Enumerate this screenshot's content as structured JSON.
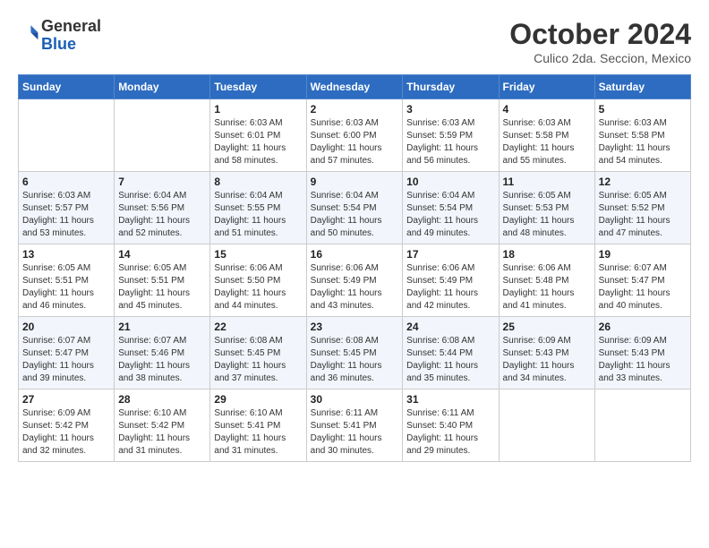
{
  "header": {
    "logo": {
      "line1": "General",
      "line2": "Blue"
    },
    "title": "October 2024",
    "location": "Culico 2da. Seccion, Mexico"
  },
  "weekdays": [
    "Sunday",
    "Monday",
    "Tuesday",
    "Wednesday",
    "Thursday",
    "Friday",
    "Saturday"
  ],
  "weeks": [
    [
      {
        "day": "",
        "info": ""
      },
      {
        "day": "",
        "info": ""
      },
      {
        "day": "1",
        "info": "Sunrise: 6:03 AM\nSunset: 6:01 PM\nDaylight: 11 hours\nand 58 minutes."
      },
      {
        "day": "2",
        "info": "Sunrise: 6:03 AM\nSunset: 6:00 PM\nDaylight: 11 hours\nand 57 minutes."
      },
      {
        "day": "3",
        "info": "Sunrise: 6:03 AM\nSunset: 5:59 PM\nDaylight: 11 hours\nand 56 minutes."
      },
      {
        "day": "4",
        "info": "Sunrise: 6:03 AM\nSunset: 5:58 PM\nDaylight: 11 hours\nand 55 minutes."
      },
      {
        "day": "5",
        "info": "Sunrise: 6:03 AM\nSunset: 5:58 PM\nDaylight: 11 hours\nand 54 minutes."
      }
    ],
    [
      {
        "day": "6",
        "info": "Sunrise: 6:03 AM\nSunset: 5:57 PM\nDaylight: 11 hours\nand 53 minutes."
      },
      {
        "day": "7",
        "info": "Sunrise: 6:04 AM\nSunset: 5:56 PM\nDaylight: 11 hours\nand 52 minutes."
      },
      {
        "day": "8",
        "info": "Sunrise: 6:04 AM\nSunset: 5:55 PM\nDaylight: 11 hours\nand 51 minutes."
      },
      {
        "day": "9",
        "info": "Sunrise: 6:04 AM\nSunset: 5:54 PM\nDaylight: 11 hours\nand 50 minutes."
      },
      {
        "day": "10",
        "info": "Sunrise: 6:04 AM\nSunset: 5:54 PM\nDaylight: 11 hours\nand 49 minutes."
      },
      {
        "day": "11",
        "info": "Sunrise: 6:05 AM\nSunset: 5:53 PM\nDaylight: 11 hours\nand 48 minutes."
      },
      {
        "day": "12",
        "info": "Sunrise: 6:05 AM\nSunset: 5:52 PM\nDaylight: 11 hours\nand 47 minutes."
      }
    ],
    [
      {
        "day": "13",
        "info": "Sunrise: 6:05 AM\nSunset: 5:51 PM\nDaylight: 11 hours\nand 46 minutes."
      },
      {
        "day": "14",
        "info": "Sunrise: 6:05 AM\nSunset: 5:51 PM\nDaylight: 11 hours\nand 45 minutes."
      },
      {
        "day": "15",
        "info": "Sunrise: 6:06 AM\nSunset: 5:50 PM\nDaylight: 11 hours\nand 44 minutes."
      },
      {
        "day": "16",
        "info": "Sunrise: 6:06 AM\nSunset: 5:49 PM\nDaylight: 11 hours\nand 43 minutes."
      },
      {
        "day": "17",
        "info": "Sunrise: 6:06 AM\nSunset: 5:49 PM\nDaylight: 11 hours\nand 42 minutes."
      },
      {
        "day": "18",
        "info": "Sunrise: 6:06 AM\nSunset: 5:48 PM\nDaylight: 11 hours\nand 41 minutes."
      },
      {
        "day": "19",
        "info": "Sunrise: 6:07 AM\nSunset: 5:47 PM\nDaylight: 11 hours\nand 40 minutes."
      }
    ],
    [
      {
        "day": "20",
        "info": "Sunrise: 6:07 AM\nSunset: 5:47 PM\nDaylight: 11 hours\nand 39 minutes."
      },
      {
        "day": "21",
        "info": "Sunrise: 6:07 AM\nSunset: 5:46 PM\nDaylight: 11 hours\nand 38 minutes."
      },
      {
        "day": "22",
        "info": "Sunrise: 6:08 AM\nSunset: 5:45 PM\nDaylight: 11 hours\nand 37 minutes."
      },
      {
        "day": "23",
        "info": "Sunrise: 6:08 AM\nSunset: 5:45 PM\nDaylight: 11 hours\nand 36 minutes."
      },
      {
        "day": "24",
        "info": "Sunrise: 6:08 AM\nSunset: 5:44 PM\nDaylight: 11 hours\nand 35 minutes."
      },
      {
        "day": "25",
        "info": "Sunrise: 6:09 AM\nSunset: 5:43 PM\nDaylight: 11 hours\nand 34 minutes."
      },
      {
        "day": "26",
        "info": "Sunrise: 6:09 AM\nSunset: 5:43 PM\nDaylight: 11 hours\nand 33 minutes."
      }
    ],
    [
      {
        "day": "27",
        "info": "Sunrise: 6:09 AM\nSunset: 5:42 PM\nDaylight: 11 hours\nand 32 minutes."
      },
      {
        "day": "28",
        "info": "Sunrise: 6:10 AM\nSunset: 5:42 PM\nDaylight: 11 hours\nand 31 minutes."
      },
      {
        "day": "29",
        "info": "Sunrise: 6:10 AM\nSunset: 5:41 PM\nDaylight: 11 hours\nand 31 minutes."
      },
      {
        "day": "30",
        "info": "Sunrise: 6:11 AM\nSunset: 5:41 PM\nDaylight: 11 hours\nand 30 minutes."
      },
      {
        "day": "31",
        "info": "Sunrise: 6:11 AM\nSunset: 5:40 PM\nDaylight: 11 hours\nand 29 minutes."
      },
      {
        "day": "",
        "info": ""
      },
      {
        "day": "",
        "info": ""
      }
    ]
  ]
}
